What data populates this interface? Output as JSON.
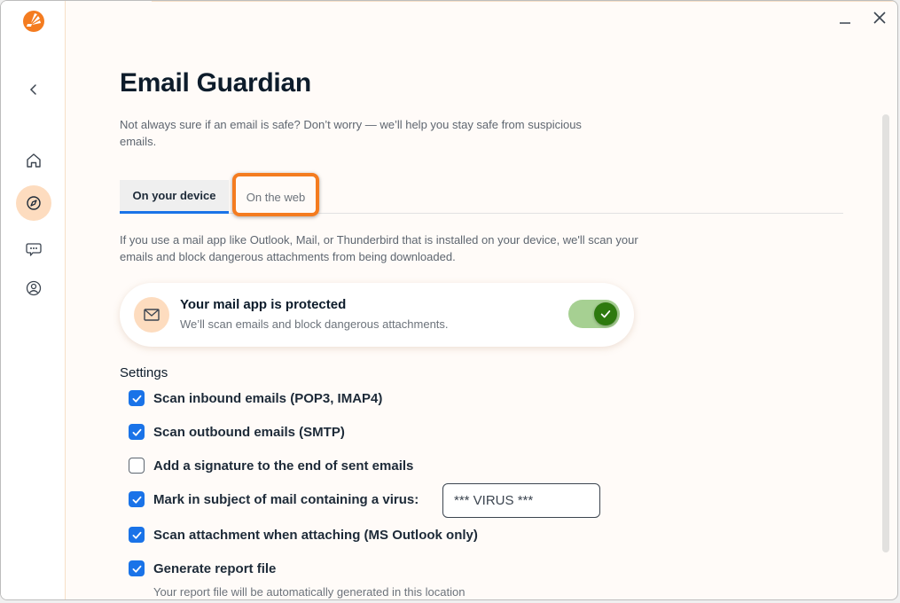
{
  "app": {
    "logo_icon": "avast-logo-icon",
    "window_controls": {
      "minimize_icon": "minimize-icon",
      "close_icon": "close-icon"
    }
  },
  "sidebar": {
    "items": [
      {
        "name": "back",
        "icon": "chevron-left-icon",
        "active": false
      },
      {
        "name": "home",
        "icon": "home-icon",
        "active": false
      },
      {
        "name": "explore",
        "icon": "compass-icon",
        "active": true
      },
      {
        "name": "chat",
        "icon": "chat-icon",
        "active": false
      },
      {
        "name": "account",
        "icon": "user-icon",
        "active": false
      }
    ]
  },
  "header": {
    "title": "Email Guardian",
    "subtitle": "Not always sure if an email is safe? Don’t worry — we’ll help you stay safe from suspicious emails."
  },
  "tabs": [
    {
      "label": "On your device",
      "active": true
    },
    {
      "label": "On the web",
      "active": false,
      "highlighted": true
    }
  ],
  "device_tab": {
    "description": "If you use a mail app like Outlook, Mail, or Thunderbird that is installed on your device, we'll scan your emails and block dangerous attachments from being downloaded.",
    "status_card": {
      "icon": "mail-icon",
      "title": "Your mail app is protected",
      "subtitle": "We’ll scan emails and block dangerous attachments.",
      "toggle_on": true
    },
    "settings_label": "Settings",
    "settings": [
      {
        "label": "Scan inbound emails (POP3, IMAP4)",
        "checked": true
      },
      {
        "label": "Scan outbound emails (SMTP)",
        "checked": true
      },
      {
        "label": "Add a signature to the end of sent emails",
        "checked": false
      },
      {
        "label": "Mark in subject of mail containing a virus:",
        "checked": true,
        "input_value": "*** VIRUS ***"
      },
      {
        "label": "Scan attachment when attaching (MS Outlook only)",
        "checked": true
      },
      {
        "label": "Generate report file",
        "checked": true
      }
    ],
    "report_note": "Your report file will be automatically generated in this location"
  },
  "colors": {
    "accent": "#1a73e8",
    "brand": "#f47c20",
    "toggle_on": "#2d7a0e",
    "highlight": "#f47c20"
  }
}
